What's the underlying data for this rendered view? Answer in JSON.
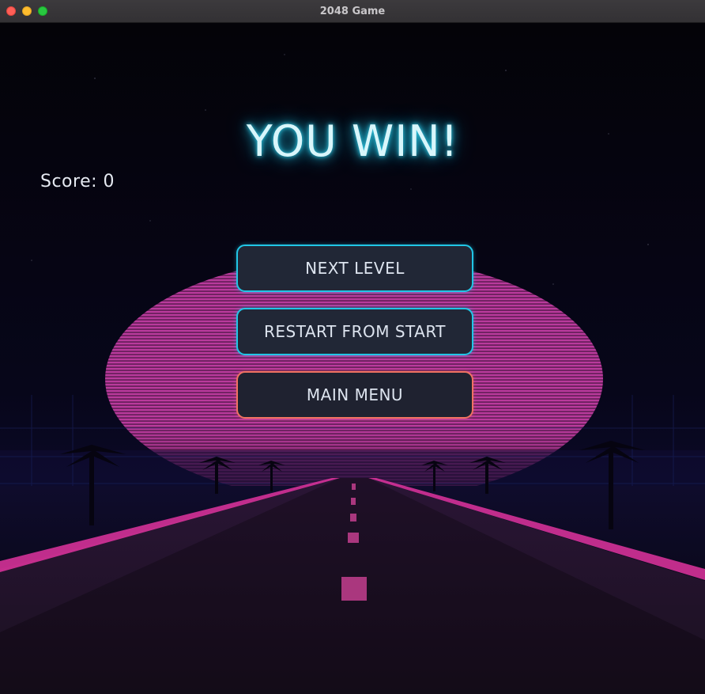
{
  "window": {
    "title": "2048 Game",
    "controls": [
      "close",
      "minimize",
      "maximize"
    ]
  },
  "game": {
    "headline": "YOU WIN!",
    "score_text": "Score: 0",
    "score": 0
  },
  "menu": {
    "buttons": [
      {
        "label": "NEXT LEVEL",
        "style": "cyan"
      },
      {
        "label": "RESTART FROM START",
        "style": "cyan"
      },
      {
        "label": "MAIN MENU",
        "style": "coral"
      }
    ]
  },
  "background": {
    "theme": "synthwave sunset road with palm trees",
    "colors": {
      "sky": "#05040a",
      "sun": "#b8339a",
      "road": "#1a1424",
      "neon_pink": "#e0349f",
      "accent_cyan": "#21c6e6",
      "accent_coral": "#f07262"
    }
  }
}
